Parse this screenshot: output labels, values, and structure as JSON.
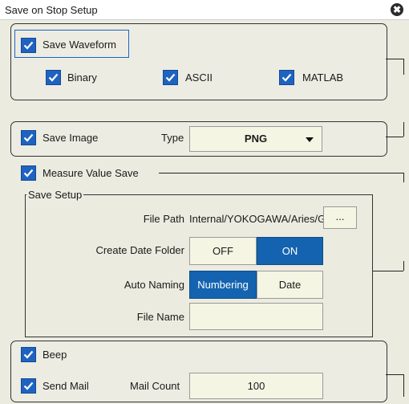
{
  "window": {
    "title": "Save on Stop Setup",
    "close_glyph": "✖"
  },
  "save_waveform": {
    "label": "Save Waveform",
    "checked": true,
    "formats": [
      {
        "label": "Binary",
        "checked": true
      },
      {
        "label": "ASCII",
        "checked": true
      },
      {
        "label": "MATLAB",
        "checked": true
      }
    ]
  },
  "save_image": {
    "label": "Save Image",
    "checked": true,
    "type_label": "Type",
    "type_value": "PNG"
  },
  "measure_value_save": {
    "label": "Measure Value Save",
    "checked": true
  },
  "save_setup": {
    "legend": "Save Setup",
    "file_path_label": "File Path",
    "file_path_value": "Internal/YOKOGAWA/Aries/Gener",
    "browse_label": "...",
    "create_date_folder_label": "Create Date Folder",
    "create_date_folder_options": [
      "OFF",
      "ON"
    ],
    "create_date_folder_selected": "ON",
    "auto_naming_label": "Auto Naming",
    "auto_naming_options": [
      "Numbering",
      "Date"
    ],
    "auto_naming_selected": "Numbering",
    "file_name_label": "File Name",
    "file_name_value": ""
  },
  "beep": {
    "label": "Beep",
    "checked": true
  },
  "send_mail": {
    "label": "Send Mail",
    "checked": true,
    "mail_count_label": "Mail Count",
    "mail_count_value": "100"
  },
  "colors": {
    "accent": "#1463b0",
    "checkbox": "#1f63c1",
    "panel": "#edece2"
  }
}
